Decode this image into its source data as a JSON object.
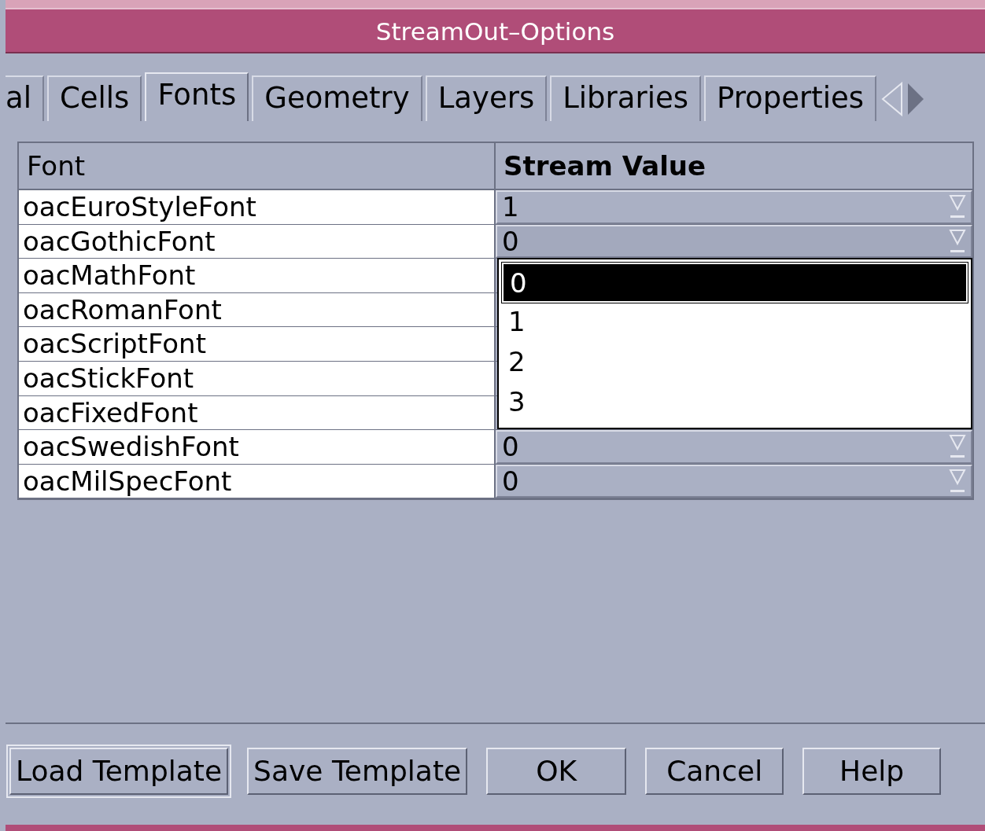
{
  "window": {
    "title": "StreamOut–Options"
  },
  "tabs": [
    {
      "label": "al",
      "selected": false
    },
    {
      "label": "Cells",
      "selected": false
    },
    {
      "label": "Fonts",
      "selected": true
    },
    {
      "label": "Geometry",
      "selected": false
    },
    {
      "label": "Layers",
      "selected": false
    },
    {
      "label": "Libraries",
      "selected": false
    },
    {
      "label": "Properties",
      "selected": false
    }
  ],
  "table": {
    "columns": [
      "Font",
      "Stream Value"
    ],
    "rows": [
      {
        "font": "oacEuroStyleFont",
        "value": "1"
      },
      {
        "font": "oacGothicFont",
        "value": "0",
        "expanded": true
      },
      {
        "font": "oacMathFont"
      },
      {
        "font": "oacRomanFont"
      },
      {
        "font": "oacScriptFont"
      },
      {
        "font": "oacStickFont"
      },
      {
        "font": "oacFixedFont"
      },
      {
        "font": "oacSwedishFont",
        "value": "0"
      },
      {
        "font": "oacMilSpecFont",
        "value": "0"
      }
    ]
  },
  "dropdown_list": {
    "options": [
      {
        "label": "0",
        "selected": true
      },
      {
        "label": "1",
        "selected": false
      },
      {
        "label": "2",
        "selected": false
      },
      {
        "label": "3",
        "selected": false
      }
    ]
  },
  "buttons": [
    "Load Template",
    "Save Template",
    "OK",
    "Cancel",
    "Help"
  ]
}
